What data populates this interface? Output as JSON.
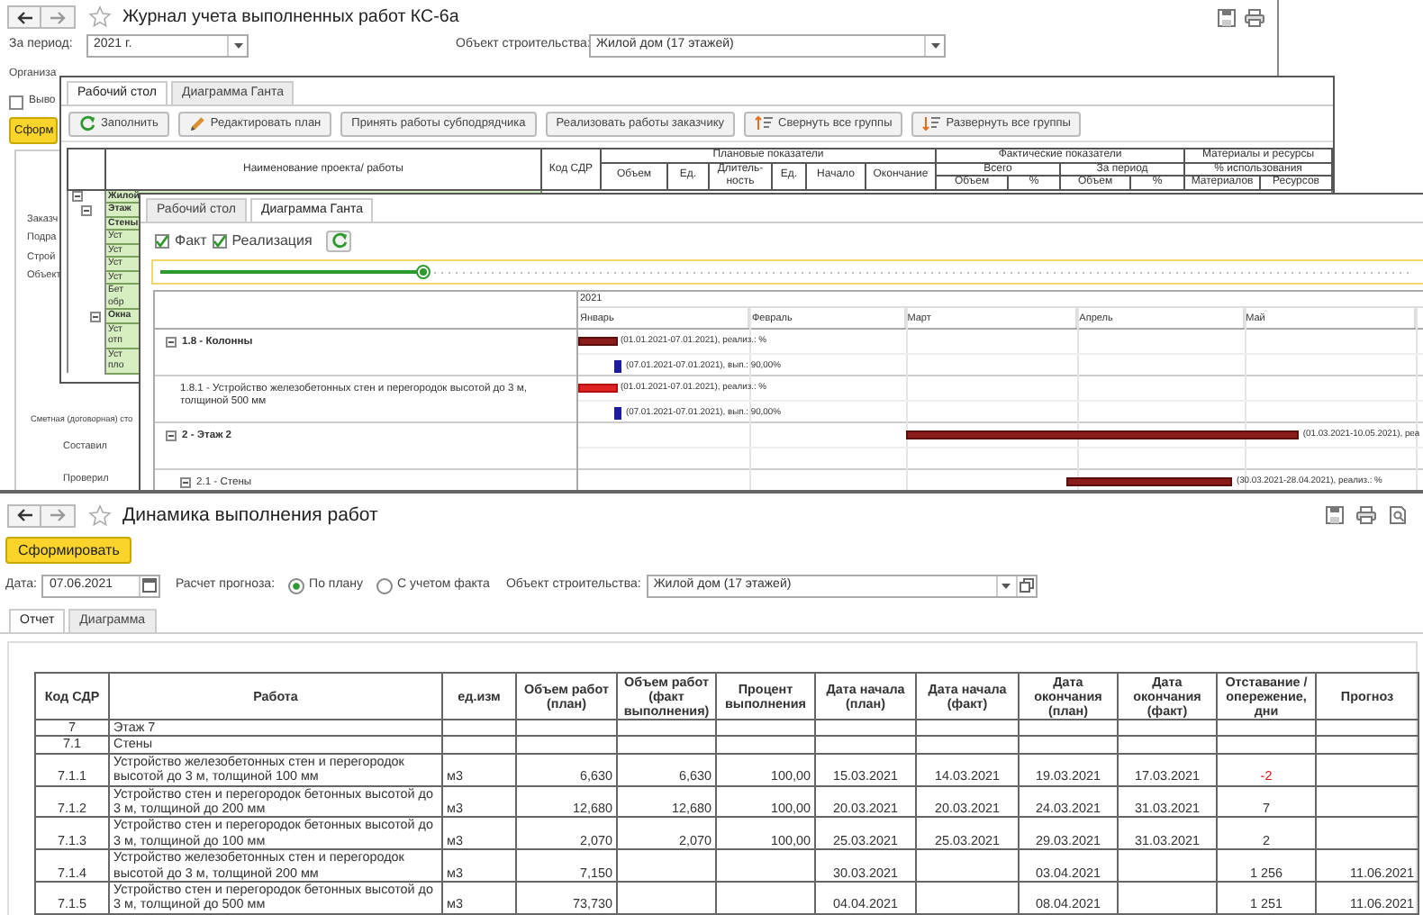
{
  "journal_window": {
    "title": "Журнал учета выполненных работ КС-6а",
    "period": {
      "label": "За период:",
      "value": "2021 г."
    },
    "object": {
      "label": "Объект строительства:",
      "value": "Жилой дом (17 этажей)"
    },
    "organization_label": "Организа",
    "output_option": {
      "label": "Выво",
      "checked": false
    },
    "generate_button": "Сформ",
    "report_labels": [
      "Заказч",
      "Подра",
      "Строй",
      "Объект"
    ],
    "footer_labels": [
      "Сметная (договорная) сто",
      "Составил",
      "Проверил"
    ]
  },
  "workplace_window": {
    "tabs": [
      {
        "label": "Рабочий стол",
        "selected": true
      },
      {
        "label": "Диаграмма Ганта",
        "selected": false
      }
    ],
    "toolbar": [
      "Заполнить",
      "Редактировать план",
      "Принять работы субподрядчика",
      "Реализовать работы заказчику",
      "Свернуть все группы",
      "Развернуть все группы"
    ],
    "table": {
      "name_header": "Наименование проекта/ работы",
      "code_header": "Код СДР",
      "plan_header": "Плановые показатели",
      "plan_columns": [
        "Объем",
        "Ед.",
        "Длитель-ность",
        "Ед.",
        "Начало",
        "Окончание"
      ],
      "fact_header": "Фактические показатели",
      "fact_groups": [
        {
          "label": "Всего",
          "columns": [
            "Объем",
            "%"
          ]
        },
        {
          "label": "За период",
          "columns": [
            "Объем",
            "%"
          ]
        }
      ],
      "materials_header": "Материалы и ресурсы",
      "materials_group": "% использования",
      "materials_columns": [
        "Материалов",
        "Ресурсов"
      ],
      "tree": [
        {
          "label": "Жилой",
          "expanded": true,
          "children": [
            {
              "label": "Этаж",
              "expanded": true,
              "children": [
                {
                  "label": "Стены",
                  "children": [
                    {
                      "label": "Уст"
                    },
                    {
                      "label": "Уст"
                    },
                    {
                      "label": "Уст"
                    },
                    {
                      "label": "Уст"
                    },
                    {
                      "label": "Бет обр"
                    }
                  ]
                },
                {
                  "label": "Окна",
                  "expanded": true,
                  "children": [
                    {
                      "label": "Уст отп"
                    },
                    {
                      "label": "Уст пло"
                    }
                  ]
                }
              ]
            }
          ]
        }
      ]
    }
  },
  "gantt_window": {
    "tabs": [
      {
        "label": "Рабочий стол",
        "selected": false
      },
      {
        "label": "Диаграмма Ганта",
        "selected": true
      }
    ],
    "options": [
      {
        "label": "Факт",
        "checked": true
      },
      {
        "label": "Реализация",
        "checked": true
      }
    ],
    "scale": {
      "level": 0.21
    },
    "year": "2021",
    "months": [
      "Январь",
      "Февраль",
      "Март",
      "Апрель",
      "Май"
    ],
    "tasks": [
      {
        "label": "1.8 - Колонны",
        "expanded": true,
        "bars": [
          {
            "kind": "summary",
            "label": "(01.01.2021-07.01.2021), реализ.: %"
          },
          {
            "kind": "fact",
            "label": "(07.01.2021-07.01.2021), вып.: 90,00%"
          }
        ],
        "children": [
          {
            "label": "1.8.1 - Устройство железобетонных стен и перегородок высотой до 3 м, толщиной 500 мм",
            "bars": [
              {
                "kind": "plan",
                "label": "(01.01.2021-07.01.2021), реализ.: %"
              },
              {
                "kind": "fact",
                "label": "(07.01.2021-07.01.2021), вып.: 90,00%"
              }
            ]
          }
        ]
      },
      {
        "label": "2 - Этаж 2",
        "expanded": true,
        "bars": [
          {
            "kind": "summary",
            "label": "(01.03.2021-10.05.2021), реа"
          }
        ],
        "children": [
          {
            "label": "2.1 - Стены",
            "expanded": true,
            "bars": [
              {
                "kind": "summary",
                "label": "(30.03.2021-28.04.2021), реализ.: %"
              }
            ]
          }
        ]
      }
    ]
  },
  "dynamics_window": {
    "title": "Динамика выполнения работ",
    "generate_button": "Сформировать",
    "date": {
      "label": "Дата:",
      "value": "07.06.2021"
    },
    "forecast": {
      "label": "Расчет прогноза:",
      "options": [
        {
          "label": "По плану",
          "selected": true
        },
        {
          "label": "С учетом факта",
          "selected": false
        }
      ]
    },
    "object": {
      "label": "Объект строительства:",
      "value": "Жилой дом (17 этажей)"
    },
    "tabs": [
      {
        "label": "Отчет",
        "selected": true
      },
      {
        "label": "Диаграмма",
        "selected": false
      }
    ],
    "table": {
      "columns": [
        "Код СДР",
        "Работа",
        "ед.изм",
        "Объем работ (план)",
        "Объем работ (факт выполнения)",
        "Процент выполнения",
        "Дата начала (план)",
        "Дата начала (факт)",
        "Дата окончания (план)",
        "Дата окончания (факт)",
        "Отставание / опережение, дни",
        "Прогноз"
      ],
      "rows": [
        {
          "code": "7",
          "work": "Этаж 7"
        },
        {
          "code": "7.1",
          "work": "Стены"
        },
        {
          "code": "7.1.1",
          "work": "Устройство железобетонных стен и перегородок высотой до 3 м, толщиной 100 мм",
          "unit": "м3",
          "volume_plan": "6,630",
          "volume_fact": "6,630",
          "percent": "100,00",
          "start_plan": "15.03.2021",
          "start_fact": "14.03.2021",
          "end_plan": "19.03.2021",
          "end_fact": "17.03.2021",
          "lag": "-2",
          "lag_alert": true
        },
        {
          "code": "7.1.2",
          "work": "Устройство стен и перегородок бетонных высотой до 3 м, толщиной до 200 мм",
          "unit": "м3",
          "volume_plan": "12,680",
          "volume_fact": "12,680",
          "percent": "100,00",
          "start_plan": "20.03.2021",
          "start_fact": "20.03.2021",
          "end_plan": "24.03.2021",
          "end_fact": "31.03.2021",
          "lag": "7",
          "lag_alert": false
        },
        {
          "code": "7.1.3",
          "work": "Устройство стен и перегородок бетонных высотой до 3 м, толщиной до 100 мм",
          "unit": "м3",
          "volume_plan": "2,070",
          "volume_fact": "2,070",
          "percent": "100,00",
          "start_plan": "25.03.2021",
          "start_fact": "25.03.2021",
          "end_plan": "29.03.2021",
          "end_fact": "31.03.2021",
          "lag": "2",
          "lag_alert": false
        },
        {
          "code": "7.1.4",
          "work": "Устройство железобетонных стен и перегородок высотой до 3 м, толщиной 200 мм",
          "unit": "м3",
          "volume_plan": "7,150",
          "start_plan": "30.03.2021",
          "end_plan": "03.04.2021",
          "lag": "1 256",
          "lag_alert": false,
          "forecast": "11.06.2021"
        },
        {
          "code": "7.1.5",
          "work": "Устройство стен и перегородок бетонных высотой до 3 м, толщиной до 500 мм",
          "unit": "м3",
          "volume_plan": "73,730",
          "start_plan": "04.04.2021",
          "end_plan": "08.04.2021",
          "lag": "1 251",
          "lag_alert": false,
          "forecast": "11.06.2021"
        }
      ]
    }
  }
}
